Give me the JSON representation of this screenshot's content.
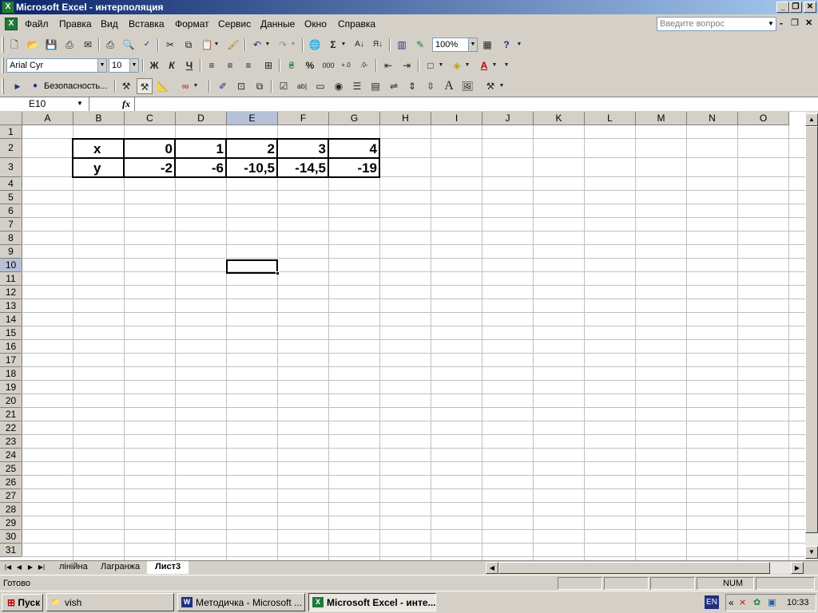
{
  "window": {
    "title": "Microsoft Excel - интерполяция",
    "app_icon": "excel-icon",
    "controls": [
      "minimize",
      "restore",
      "close"
    ]
  },
  "menubar": {
    "items": [
      "Файл",
      "Правка",
      "Вид",
      "Вставка",
      "Формат",
      "Сервис",
      "Данные",
      "Окно",
      "Справка"
    ],
    "ask_placeholder": "Введите вопрос"
  },
  "toolbar_standard": {
    "zoom": "100%"
  },
  "toolbar_formatting": {
    "font": "Arial Cyr",
    "size": "10",
    "bold": "Ж",
    "italic": "К",
    "underline": "Ч",
    "percent": "%",
    "thousands": "000"
  },
  "toolbar_forms": {
    "security_label": "Безопасность..."
  },
  "formula_bar": {
    "name_box": "E10",
    "fx": "fx",
    "content": ""
  },
  "grid": {
    "columns": [
      "A",
      "B",
      "C",
      "D",
      "E",
      "F",
      "G",
      "H",
      "I",
      "J",
      "K",
      "L",
      "M",
      "N",
      "O"
    ],
    "rows": [
      "1",
      "2",
      "3",
      "4",
      "5",
      "6",
      "7",
      "8",
      "9",
      "10",
      "11",
      "12",
      "13",
      "14",
      "15",
      "16",
      "17",
      "18",
      "19",
      "20",
      "21",
      "22",
      "23",
      "24",
      "25",
      "26",
      "27",
      "28",
      "29",
      "30",
      "31"
    ],
    "selected_column": "E",
    "selected_row": "10",
    "table": {
      "row_x": {
        "label": "x",
        "values": [
          "0",
          "1",
          "2",
          "3",
          "4"
        ]
      },
      "row_y": {
        "label": "y",
        "values": [
          "-2",
          "-6",
          "-10,5",
          "-14,5",
          "-19"
        ]
      }
    }
  },
  "sheets": {
    "tabs": [
      "лінійна",
      "Лагранжа",
      "Лист3"
    ],
    "active": "Лист3"
  },
  "statusbar": {
    "status": "Готово",
    "num": "NUM"
  },
  "taskbar": {
    "start": "Пуск",
    "tasks": [
      {
        "label": "vish",
        "icon": "folder-icon"
      },
      {
        "label": "Методичка - Microsoft ...",
        "icon": "word-icon"
      },
      {
        "label": "Microsoft Excel - инте...",
        "icon": "excel-icon"
      }
    ],
    "lang": "EN",
    "time": "10:33"
  }
}
